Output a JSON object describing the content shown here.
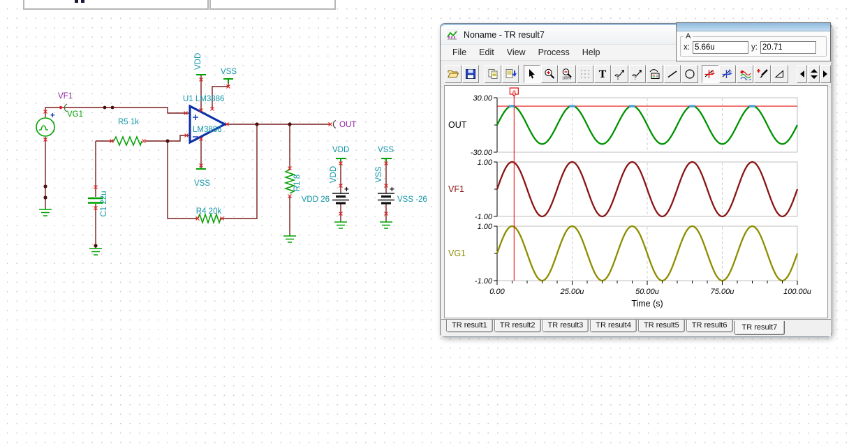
{
  "schematic": {
    "labels": {
      "vf1": "VF1",
      "vg1": "VG1",
      "source_plus": "+",
      "r5": "R5 1k",
      "c1": "C1 22u",
      "u1": "U1 LM3886",
      "opamp_chip": "LM3886",
      "opamp_vdd_pin": "VDD",
      "opamp_vss_pin_top": "VSS",
      "opamp_vss_pin_bottom": "VSS",
      "r4": "R4 20k",
      "r1": "R1 8",
      "out": "OUT",
      "vdd_rail": "VDD",
      "vdd_wire": "VDD",
      "vdd_source": "VDD 26",
      "vdd_plus": "+",
      "vss_rail": "VSS",
      "vss_wire": "VSS",
      "vss_source": "VSS -26",
      "vss_plus": "+"
    },
    "colors": {
      "wire": "#7a1b1b",
      "component_green": "#00a000",
      "label_teal": "#1296a6",
      "label_purple": "#9023a0",
      "label_green": "#00a000",
      "opamp_blue": "#0a2fa8",
      "terminal_red": "#e02020",
      "junction_maroon": "#4d0f0f",
      "battery_black": "#111111"
    }
  },
  "window": {
    "title": "Noname - TR result7",
    "menu": [
      "File",
      "Edit",
      "View",
      "Process",
      "Help"
    ],
    "cursor_panel": {
      "legend": "A",
      "x_label": "x:",
      "x_value": "5.66u",
      "y_label": "y:",
      "y_value": "20.71"
    },
    "toolbar_icons": [
      "open",
      "save",
      "copy",
      "copy-special",
      "pointer",
      "zoom-in",
      "zoom-out-100",
      "grid",
      "text",
      "annotate-time",
      "annotate-query",
      "legend",
      "line",
      "ellipse",
      "cursor-a",
      "cursor-b",
      "add-curve",
      "trace-picker",
      "corner-marker",
      "nav-left",
      "nav-spinner",
      "nav-right"
    ],
    "tabs": [
      "TR result1",
      "TR result2",
      "TR result3",
      "TR result4",
      "TR result5",
      "TR result6",
      "TR result7"
    ],
    "active_tab": "TR result7"
  },
  "chart_data": {
    "type": "line",
    "xlabel": "Time (s)",
    "x_range_us": [
      0,
      100
    ],
    "x_ticks": [
      {
        "t_us": 0,
        "label": "0.00"
      },
      {
        "t_us": 25,
        "label": "25.00u"
      },
      {
        "t_us": 50,
        "label": "50.00u"
      },
      {
        "t_us": 75,
        "label": "75.00u"
      },
      {
        "t_us": 100,
        "label": "100.00u"
      }
    ],
    "minor_tick_step_us": 5,
    "grid_dashed_at_us": [
      25,
      50,
      75
    ],
    "waveform": {
      "shape": "sine",
      "period_us": 20,
      "phase_deg": 0,
      "cycles": 5
    },
    "panels": [
      {
        "name": "OUT",
        "color": "#009300",
        "label_color": "#000000",
        "amplitude": 21,
        "ylim": [
          -30,
          30
        ],
        "ymax_label": "30.00",
        "ymin_label": "-30.00"
      },
      {
        "name": "VF1",
        "color": "#8b1414",
        "label_color": "#8b1414",
        "amplitude": 1,
        "ylim": [
          -1,
          1
        ],
        "ymax_label": "1.00",
        "ymin_label": "-1.00"
      },
      {
        "name": "VG1",
        "color": "#8d8d00",
        "label_color": "#8d8d00",
        "amplitude": 1,
        "ylim": [
          -1,
          1
        ],
        "ymax_label": "1.00",
        "ymin_label": "-1.00"
      }
    ],
    "cursor_a": {
      "label": "a",
      "x_us": 5.66,
      "y_value": 20.71,
      "panel": "OUT",
      "line_color": "#e81111",
      "peak_marker_color": "#3f9fd8",
      "peak_times_us": [
        5,
        25,
        45,
        65,
        85
      ]
    }
  }
}
